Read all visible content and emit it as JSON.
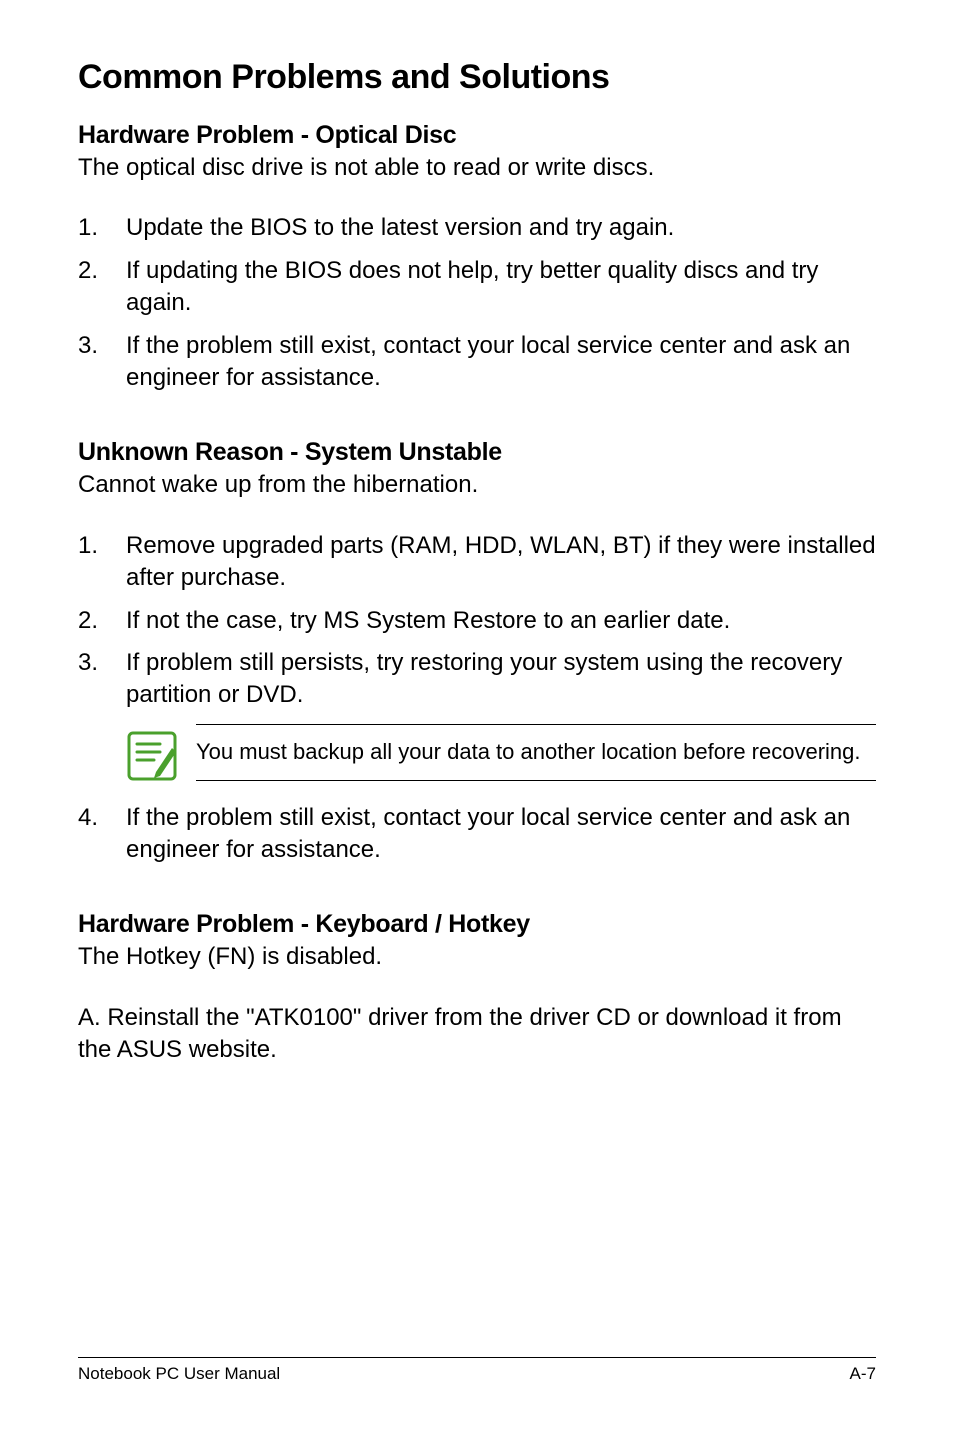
{
  "page_title": "Common Problems and Solutions",
  "section1": {
    "heading": "Hardware Problem - Optical Disc",
    "intro": "The optical disc drive is not able to read or write discs.",
    "items": [
      {
        "num": "1.",
        "text": "Update the BIOS to the latest version and try again."
      },
      {
        "num": "2.",
        "text": "If updating the BIOS does not help, try better quality discs and try again."
      },
      {
        "num": "3.",
        "text": "If the problem still exist, contact your local service center and ask an engineer for assistance."
      }
    ]
  },
  "section2": {
    "heading": "Unknown Reason - System Unstable",
    "intro": "Cannot wake up from the hibernation.",
    "items": [
      {
        "num": "1.",
        "text": "Remove upgraded parts (RAM, HDD, WLAN, BT) if they were installed after purchase."
      },
      {
        "num": "2.",
        "text": "If not the case, try MS System Restore to an earlier date."
      },
      {
        "num": "3.",
        "text": "If problem still persists, try restoring your system using the recovery partition or DVD."
      }
    ],
    "note": "You must backup all your data to another location before recovering.",
    "item4": {
      "num": "4.",
      "text": "If the problem still exist, contact your local service center and ask an engineer for assistance."
    }
  },
  "section3": {
    "heading": "Hardware Problem - Keyboard / Hotkey",
    "intro": "The Hotkey (FN) is disabled.",
    "answer": "A. Reinstall the \"ATK0100\" driver from the driver CD or download it from the ASUS website."
  },
  "footer": {
    "left": "Notebook PC User Manual",
    "right": "A-7"
  }
}
